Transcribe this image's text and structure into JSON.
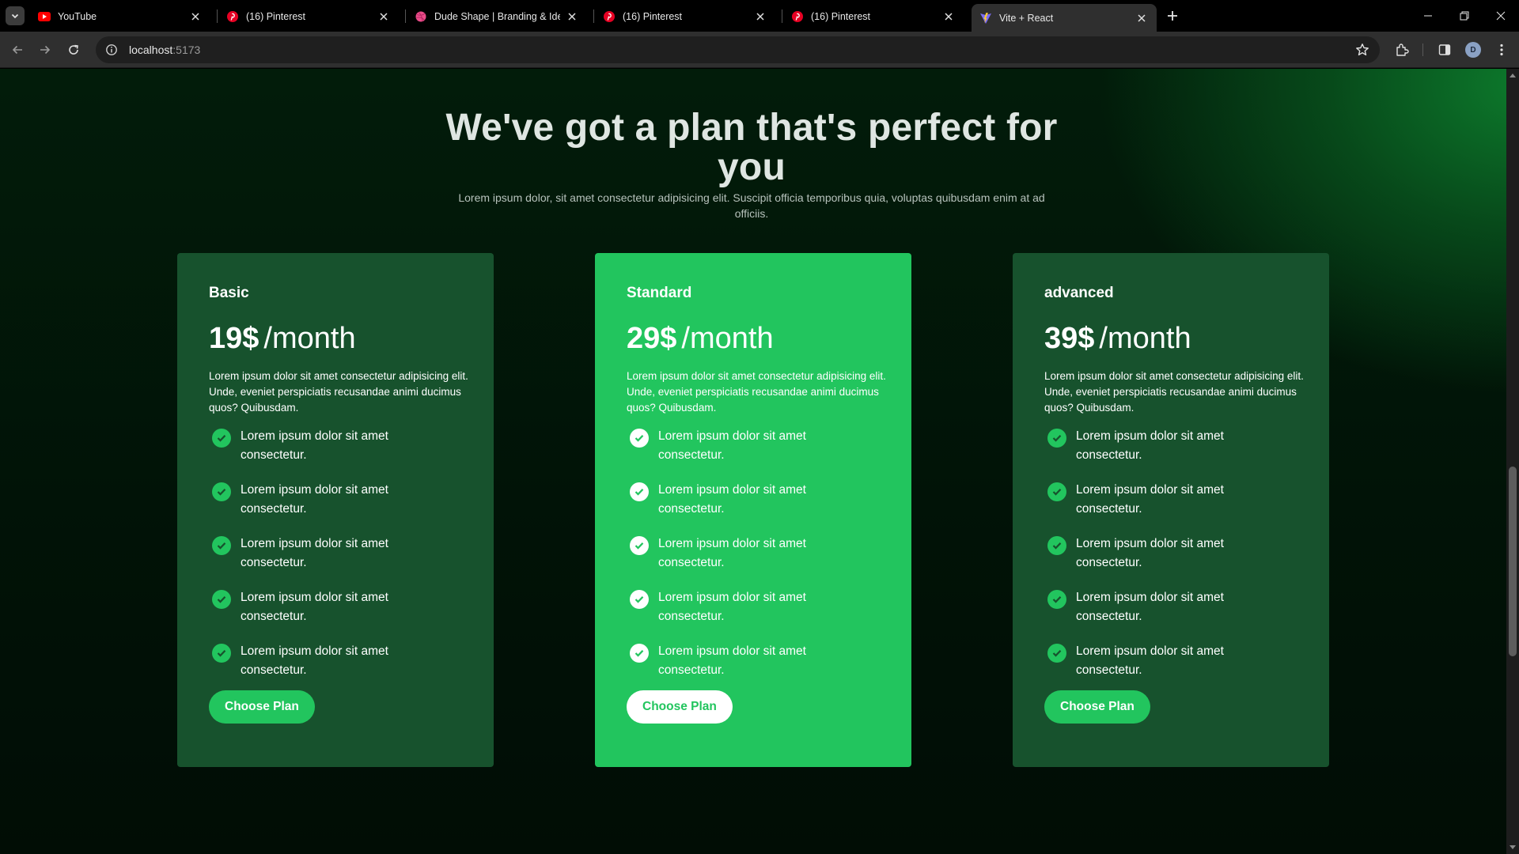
{
  "browser": {
    "tabs": [
      {
        "title": "YouTube",
        "icon": "youtube-icon",
        "active": false
      },
      {
        "title": "(16) Pinterest",
        "icon": "pinterest-icon",
        "active": false
      },
      {
        "title": "Dude Shape | Branding & Identity",
        "icon": "dribbble-icon",
        "active": false
      },
      {
        "title": "(16) Pinterest",
        "icon": "pinterest-icon",
        "active": false
      },
      {
        "title": "(16) Pinterest",
        "icon": "pinterest-icon",
        "active": false
      },
      {
        "title": "Vite + React",
        "icon": "vite-icon",
        "active": true
      }
    ],
    "url_host": "localhost",
    "url_port": ":5173",
    "profile_initial": "D",
    "colors": {
      "youtube": "#ff0000",
      "pinterest": "#e60023",
      "dribbble": "#ea4c89"
    }
  },
  "page": {
    "heading": "We've got a plan that's perfect for you",
    "subheading": "Lorem ipsum dolor, sit amet consectetur adipisicing elit. Suscipit officia temporibus quia, voluptas quibusdam enim at ad officiis.",
    "colors": {
      "accent": "#22c55e",
      "card_dark": "#17522d",
      "background": "#021c0a"
    },
    "plans": [
      {
        "name": "Basic",
        "price": "19$",
        "period": "/month",
        "description": "Lorem ipsum dolor sit amet consectetur adipisicing elit. Unde, eveniet perspiciatis recusandae animi ducimus quos? Quibusdam.",
        "features": [
          "Lorem ipsum dolor sit amet consectetur.",
          "Lorem ipsum dolor sit amet consectetur.",
          "Lorem ipsum dolor sit amet consectetur.",
          "Lorem ipsum dolor sit amet consectetur.",
          "Lorem ipsum dolor sit amet consectetur."
        ],
        "cta": "Choose Plan"
      },
      {
        "name": "Standard",
        "price": "29$",
        "period": "/month",
        "description": "Lorem ipsum dolor sit amet consectetur adipisicing elit. Unde, eveniet perspiciatis recusandae animi ducimus quos? Quibusdam.",
        "features": [
          "Lorem ipsum dolor sit amet consectetur.",
          "Lorem ipsum dolor sit amet consectetur.",
          "Lorem ipsum dolor sit amet consectetur.",
          "Lorem ipsum dolor sit amet consectetur.",
          "Lorem ipsum dolor sit amet consectetur."
        ],
        "cta": "Choose Plan"
      },
      {
        "name": "advanced",
        "price": "39$",
        "period": "/month",
        "description": "Lorem ipsum dolor sit amet consectetur adipisicing elit. Unde, eveniet perspiciatis recusandae animi ducimus quos? Quibusdam.",
        "features": [
          "Lorem ipsum dolor sit amet consectetur.",
          "Lorem ipsum dolor sit amet consectetur.",
          "Lorem ipsum dolor sit amet consectetur.",
          "Lorem ipsum dolor sit amet consectetur.",
          "Lorem ipsum dolor sit amet consectetur."
        ],
        "cta": "Choose Plan"
      }
    ]
  }
}
